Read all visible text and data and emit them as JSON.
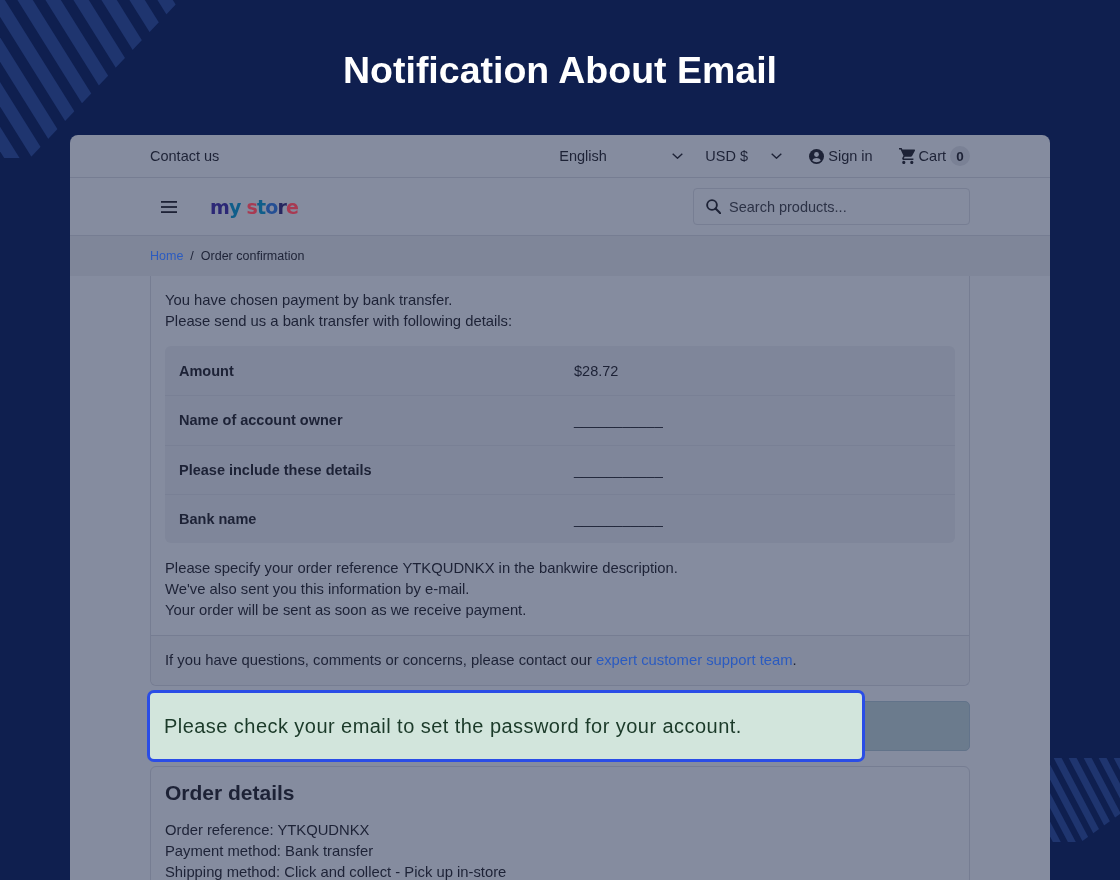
{
  "heading": "Notification About Email",
  "top_bar": {
    "contact": "Contact us",
    "language": "English",
    "currency": "USD $",
    "sign_in": "Sign in",
    "cart": {
      "label": "Cart",
      "count": "0"
    }
  },
  "header": {
    "logo": "my store",
    "search": {
      "placeholder": "Search products..."
    }
  },
  "breadcrumb": {
    "separator": "/",
    "items": [
      {
        "label": "Home",
        "kind": "link"
      },
      {
        "label": "Order confirmation",
        "kind": "current"
      }
    ]
  },
  "payment": {
    "intro": [
      "You have chosen payment by bank transfer.",
      "Please send us a bank transfer with following details:"
    ],
    "details": [
      {
        "label": "Amount",
        "value": "$28.72"
      },
      {
        "label": "Name of account owner",
        "value": "___________"
      },
      {
        "label": "Please include these details",
        "value": "___________"
      },
      {
        "label": "Bank name",
        "value": "___________"
      }
    ],
    "notes": [
      "Please specify your order reference YTKQUDNKX in the bankwire description.",
      "We've also sent you this information by e-mail.",
      "Your order will be sent as soon as we receive payment."
    ],
    "support": {
      "text": "If you have questions, comments or concerns, please contact our ",
      "link": "expert customer support team",
      "end": "."
    }
  },
  "alert": {
    "message": "Please check your email to set the password for your account."
  },
  "order_details": {
    "title": "Order details",
    "lines": [
      "Order reference: YTKQUDNKX",
      "Payment method: Bank transfer",
      "Shipping method: Click and collect - Pick up in-store"
    ]
  }
}
